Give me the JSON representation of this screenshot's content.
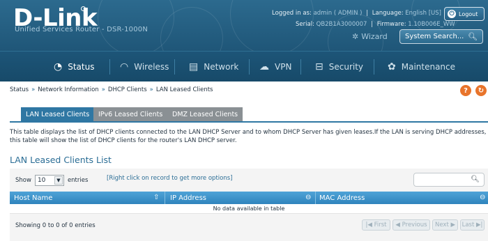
{
  "brand": {
    "logo": "D-Link",
    "subtitle": "Unified Services Router - DSR-1000N"
  },
  "session": {
    "logged_in_label": "Logged in as:",
    "user": "admin ( ADMIN )",
    "language_label": "Language:",
    "language": "English [US]",
    "serial_label": "Serial:",
    "serial": "QB2B1A3000007",
    "firmware_label": "Firmware:",
    "firmware": "1.10B006E_WW",
    "logout": "Logout",
    "wizard": "Wizard",
    "search_placeholder": "System Search..."
  },
  "nav": [
    {
      "label": "Status",
      "icon": "gauge-icon",
      "active": true
    },
    {
      "label": "Wireless",
      "icon": "wifi-icon",
      "active": false
    },
    {
      "label": "Network",
      "icon": "network-icon",
      "active": false
    },
    {
      "label": "VPN",
      "icon": "vpn-icon",
      "active": false
    },
    {
      "label": "Security",
      "icon": "lock-icon",
      "active": false
    },
    {
      "label": "Maintenance",
      "icon": "gear-icon",
      "active": false
    }
  ],
  "breadcrumb": [
    "Status",
    "Network Information",
    "DHCP Clients",
    "LAN Leased Clients"
  ],
  "breadcrumb_sep": "»",
  "help_icons": [
    "?",
    "↻"
  ],
  "tabs": [
    "LAN Leased Clients",
    "IPv6 Leased Clients",
    "DMZ Leased Clients"
  ],
  "description": "This table displays the list of DHCP clients connected to the LAN DHCP Server and to whom DHCP Server has given leases.If the LAN is serving DHCP addresses, this table will show the list of DHCP clients for the router's LAN DHCP server.",
  "section_title": "LAN Leased Clients List",
  "table": {
    "show_label": "Show",
    "entries_value": "10",
    "entries_label": "entries",
    "hint": "[Right click on record to get more options]",
    "columns": [
      "Host Name",
      "IP Address",
      "MAC Address"
    ],
    "empty": "No data available in table",
    "info": "Showing 0 to 0 of 0 entries",
    "pager": [
      "First",
      "Previous",
      "Next",
      "Last"
    ]
  },
  "colors": {
    "header": "#2c6a8e",
    "nav": "#1d5578",
    "accent": "#2f77a3",
    "help": "#e8742b"
  }
}
